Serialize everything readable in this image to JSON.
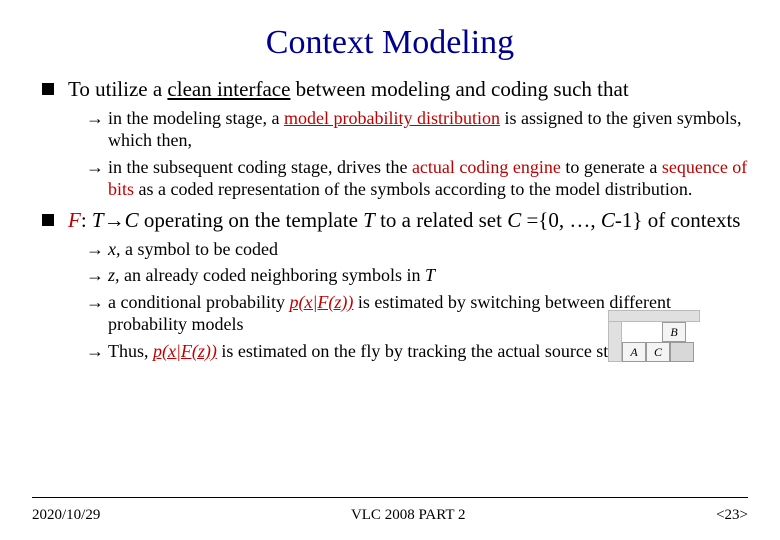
{
  "title": "Context Modeling",
  "bullets": {
    "b1_pre": "To utilize a ",
    "b1_link": "clean interface",
    "b1_post": " between modeling and coding such that",
    "b1_1a": " in the modeling stage, a ",
    "b1_1b": "model probability distribution",
    "b1_1c": " is assigned to the given symbols, which then,",
    "b1_2a": "in the subsequent coding stage, drives the ",
    "b1_2b": "actual coding engine",
    "b1_2c": " to generate a ",
    "b1_2d": "sequence of bits",
    "b1_2e": " as a coded representation of the symbols according to the model distribution.",
    "b2_F": "F",
    "b2_colon": ": ",
    "b2_T": "T",
    "b2_arrow": "→",
    "b2_C": "C",
    "b2_mid": " operating on the template ",
    "b2_T2": "T",
    "b2_mid2": " to a related set ",
    "b2_C2": "C",
    "b2_set": " ={0, …, ",
    "b2_C3": "C",
    "b2_end": "-1} of contexts",
    "b2_1a": "x,",
    "b2_1b": " a symbol to be coded",
    "b2_2a": "z,",
    "b2_2b": " an already coded neighboring symbols in ",
    "b2_2c": "T",
    "b2_3a": "a conditional probability ",
    "b2_3b": "p(x|F(z))",
    "b2_3c": " is estimated by switching between different probability models",
    "b2_4a": "Thus, ",
    "b2_4b": "p(x|F(z))",
    "b2_4c": " is estimated on the fly by tracking the actual source statistics."
  },
  "template": {
    "A": "A",
    "B": "B",
    "C": "C"
  },
  "footer": {
    "date": "2020/10/29",
    "center": "VLC 2008 PART 2",
    "page": "<23>"
  }
}
